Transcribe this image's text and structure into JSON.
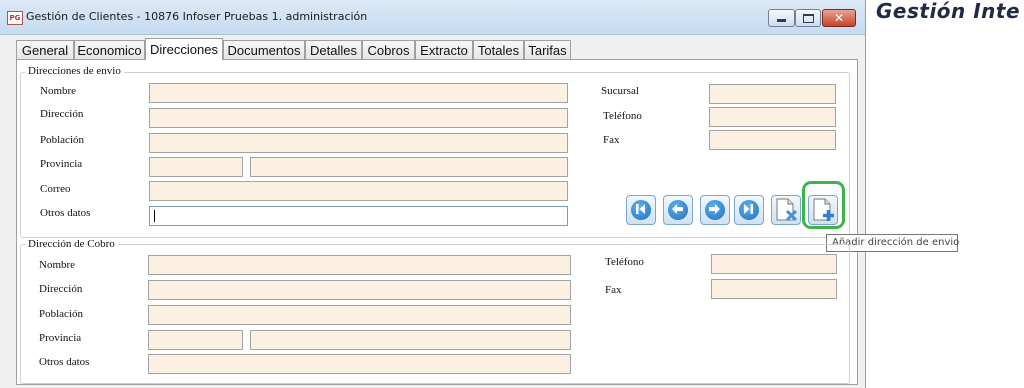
{
  "background_app": {
    "title": "Gestión Inte"
  },
  "window": {
    "app_icon": "PG",
    "title": "Gestión de Clientes - 10876 Infoser Pruebas 1. administración",
    "controls": {
      "minimize_icon": "minimize-icon",
      "maximize_icon": "maximize-icon",
      "close_icon": "close-icon"
    }
  },
  "tabs": [
    "General",
    "Economico",
    "Direcciones",
    "Documentos",
    "Detalles",
    "Cobros",
    "Extracto",
    "Totales",
    "Tarifas"
  ],
  "active_tab": "Direcciones",
  "envio": {
    "legend": "Direcciones de envio",
    "nombre_label": "Nombre",
    "direccion_label": "Dirección",
    "poblacion_label": "Población",
    "provincia_label": "Provincia",
    "correo_label": "Correo",
    "otros_label": "Otros datos",
    "sucursal_label": "Sucursal",
    "telefono_label": "Teléfono",
    "fax_label": "Fax"
  },
  "cobro": {
    "legend": "Dirección de Cobro",
    "nombre_label": "Nombre",
    "direccion_label": "Dirección",
    "poblacion_label": "Población",
    "provincia_label": "Provincia",
    "otros_label": "Otros datos",
    "telefono_label": "Teléfono",
    "fax_label": "Fax"
  },
  "nav_buttons": [
    "first-record-icon",
    "previous-record-icon",
    "next-record-icon",
    "last-record-icon",
    "delete-address-icon",
    "add-address-icon"
  ],
  "tooltip": "Añadir dirección de envio",
  "colors": {
    "field_bg": "#fbf0e1",
    "highlight": "#3bb54a",
    "nav_blue": "#1c6fbd"
  }
}
